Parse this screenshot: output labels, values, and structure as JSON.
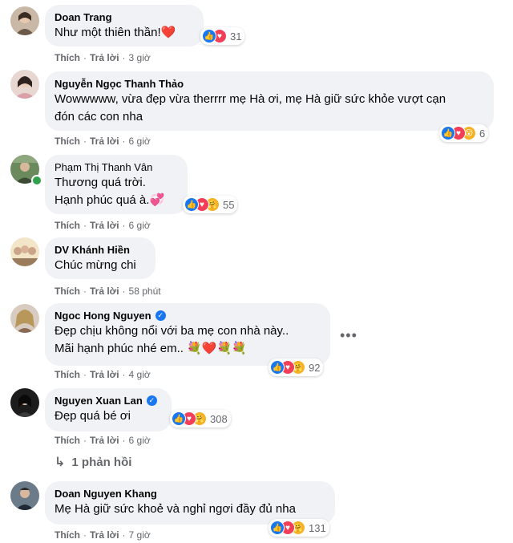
{
  "colors": {
    "bubble": "#f0f2f5",
    "meta": "#65676b",
    "like": "#1877f2",
    "love": "#f33e58",
    "care": "#f7b125"
  },
  "comments": [
    {
      "name": "Doan Trang",
      "text": "Như một thiên thần!",
      "emoji": "❤️",
      "reaction_icons": [
        "like",
        "love"
      ],
      "reaction_count": "31",
      "like": "Thích",
      "reply": "Trả lời",
      "time": "3 giờ"
    },
    {
      "name": "Nguyễn Ngọc Thanh Thảo",
      "text": "Wowwwww, vừa đẹp vừa therrrr mẹ Hà ơi, mẹ Hà giữ sức khỏe vượt cạn\nđón các con nha",
      "reaction_icons": [
        "like",
        "love",
        "wow"
      ],
      "reaction_count": "6",
      "like": "Thích",
      "reply": "Trả lời",
      "time": "6 giờ"
    },
    {
      "name": "Phạm Thị Thanh Vân",
      "text": "Thương quá trời.\nHạnh phúc quá à.",
      "emoji": "💞",
      "reaction_icons": [
        "like",
        "love",
        "care"
      ],
      "reaction_count": "55",
      "like": "Thích",
      "reply": "Trả lời",
      "time": "6 giờ"
    },
    {
      "name": "DV Khánh Hiền",
      "text": "Chúc mừng chi",
      "like": "Thích",
      "reply": "Trả lời",
      "time": "58 phút"
    },
    {
      "name": "Ngoc Hong Nguyen",
      "verified": true,
      "text": "Đẹp chịu không nổi với ba mẹ con nhà này..\nMãi hạnh phúc nhé em..",
      "emoji": "💐❤️💐💐",
      "reaction_icons": [
        "like",
        "love",
        "care"
      ],
      "reaction_count": "92",
      "like": "Thích",
      "reply": "Trả lời",
      "time": "4 giờ"
    },
    {
      "name": "Nguyen Xuan Lan",
      "verified": true,
      "text": "Đẹp quá bé ơi",
      "reaction_icons": [
        "like",
        "love",
        "care"
      ],
      "reaction_count": "308",
      "like": "Thích",
      "reply": "Trả lời",
      "time": "6 giờ"
    },
    {
      "name": "Doan Nguyen Khang",
      "text": "Mẹ Hà giữ sức khoẻ và nghỉ ngơi đầy đủ nha",
      "reaction_icons": [
        "like",
        "love",
        "care"
      ],
      "reaction_count": "131",
      "like": "Thích",
      "reply": "Trả lời",
      "time": "7 giờ"
    }
  ],
  "replies_link": "1 phản hồi",
  "verified_icon": "verified-badge-icon",
  "more_icon": "more-horizontal-icon"
}
